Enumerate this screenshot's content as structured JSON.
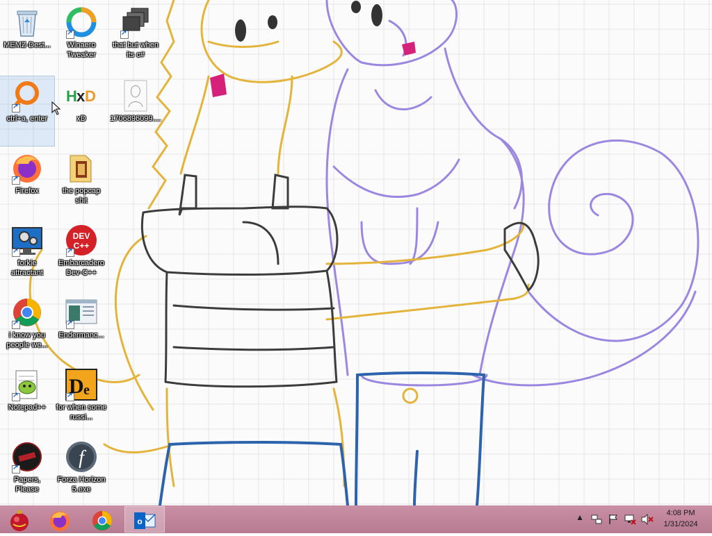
{
  "desktop": {
    "icons": [
      {
        "label": "MEMZ-Dest..."
      },
      {
        "label": "Winaero Tweaker"
      },
      {
        "label": "that but when its c#"
      },
      {
        "label": "ctrl+a, enter"
      },
      {
        "label": "xD"
      },
      {
        "label": "1706896099...."
      },
      {
        "label": "Firefox"
      },
      {
        "label": "the popcap shit"
      },
      {
        "label": "forkie attractant"
      },
      {
        "label": "Embarcadero Dev-C++"
      },
      {
        "label": "i know you people we..."
      },
      {
        "label": "Endermanc..."
      },
      {
        "label": "Notepad++"
      },
      {
        "label": "for when some russi..."
      },
      {
        "label": "Papers, Please"
      },
      {
        "label": "Forza Horizon 5.exe"
      }
    ]
  },
  "taskbar": {
    "apps": [
      {
        "icon": "ornament-start-icon"
      },
      {
        "icon": "firefox-icon"
      },
      {
        "icon": "chrome-icon"
      },
      {
        "icon": "outlook-icon",
        "active": true
      }
    ],
    "clock": {
      "time": "4:08 PM",
      "date": "1/31/2024"
    }
  },
  "colors": {
    "taskbar": "#c08498",
    "wallpaper_bg": "#fbfbfb",
    "grid": "#e4e4e4"
  }
}
